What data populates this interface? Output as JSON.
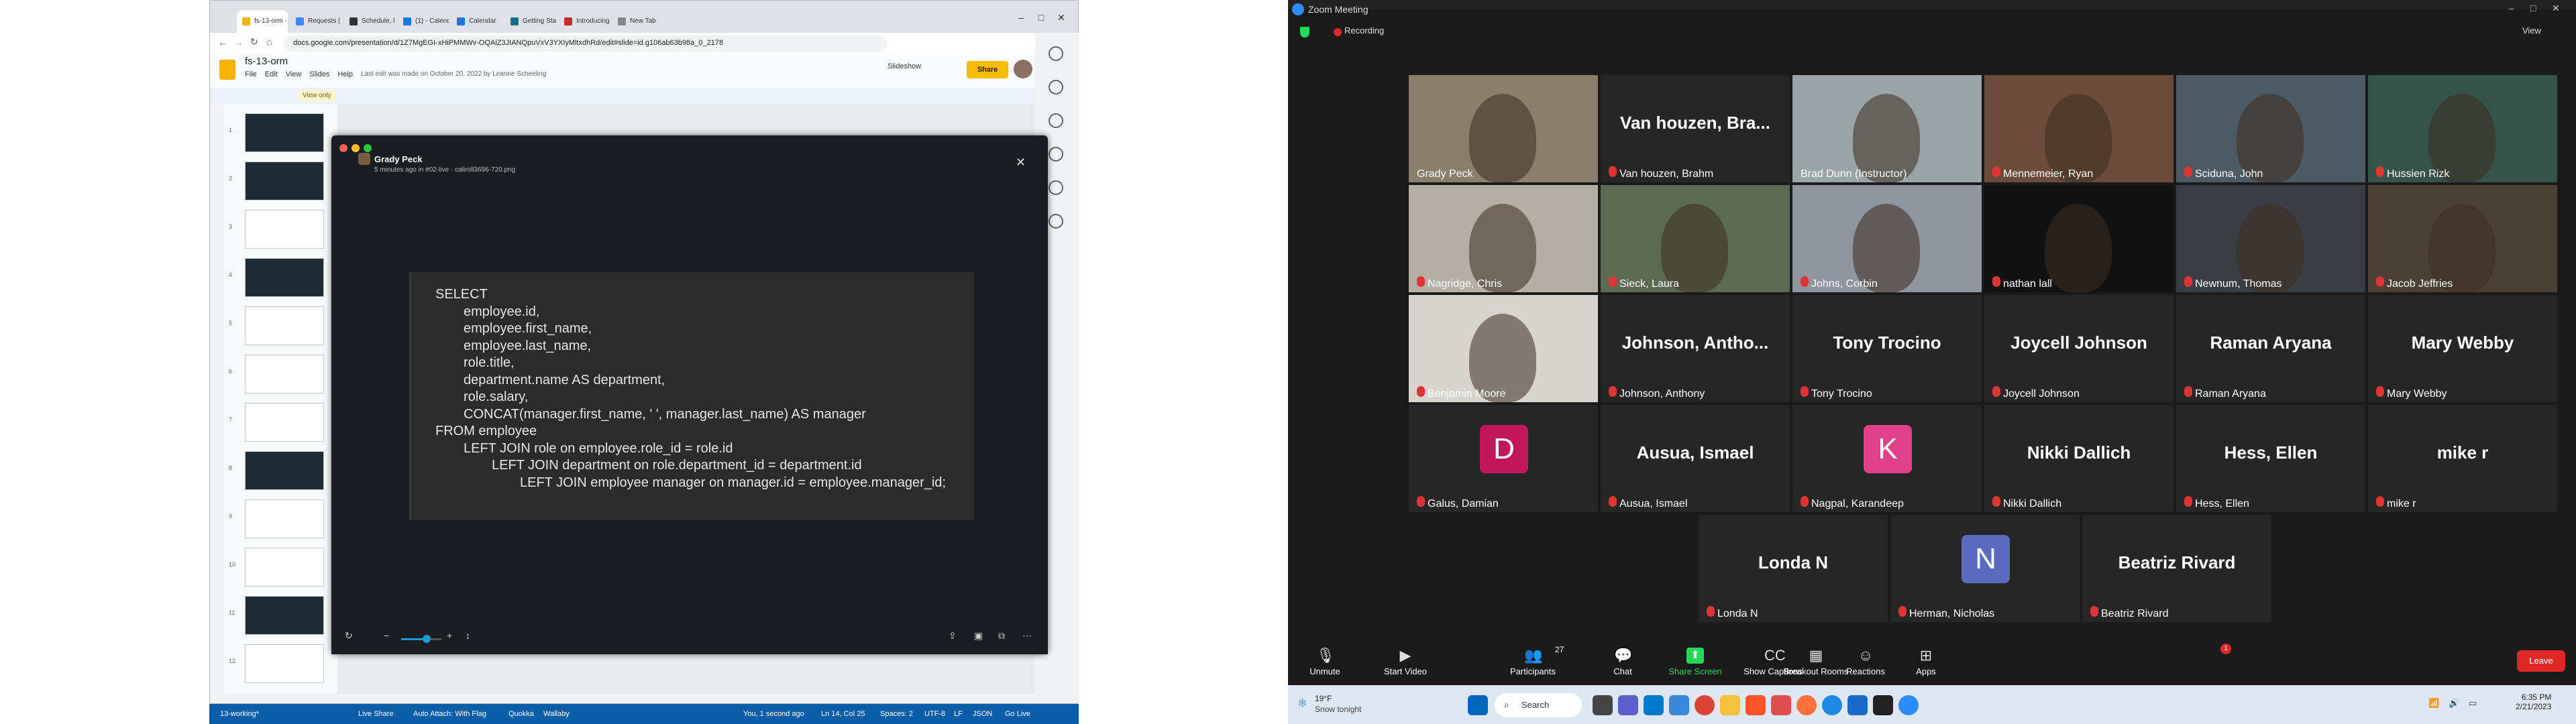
{
  "chrome": {
    "tabs": [
      {
        "label": "fs-13-orm - Google Slides",
        "color": "#f4b400",
        "active": true
      },
      {
        "label": "Requests | Instructor",
        "color": "#4285f4",
        "active": false
      },
      {
        "label": "Schedule, live/02-...",
        "color": "#333333",
        "active": false
      },
      {
        "label": "(1) - Calendar - Inst...",
        "color": "#1a73e8",
        "active": false
      },
      {
        "label": "Calendar",
        "color": "#1a73e8",
        "active": false
      },
      {
        "label": "Getting Started | E...",
        "color": "#0b7285",
        "active": false
      },
      {
        "label": "Introducing the new...",
        "color": "#c92a2a",
        "active": false
      },
      {
        "label": "New Tab",
        "color": "#888888",
        "active": false
      }
    ],
    "url": "docs.google.com/presentation/d/1Z7MgEGI-xHiPMMWv-OQAiZ3JIANQpuVxV3YXIyMltxdhRd/edit#slide=id.g106ab63b98a_0_2178"
  },
  "slides": {
    "title": "fs-13-orm",
    "menu": [
      "File",
      "Edit",
      "View",
      "Slides",
      "Help"
    ],
    "last_edit": "Last edit was made on October 20, 2022 by Leanne Scheeling",
    "slideshow_label": "Slideshow",
    "share_label": "Share",
    "view_only": "View only",
    "slide_numbers": [
      "1",
      "2",
      "3",
      "4",
      "5",
      "6",
      "7",
      "8",
      "9",
      "10",
      "11",
      "12"
    ]
  },
  "viewer": {
    "sender": "Grady Peck",
    "meta": "5 minutes ago in #02-live · caliroll3696-720.png",
    "code_lines": [
      {
        "indent": 0,
        "text": "SELECT"
      },
      {
        "indent": 1,
        "text": "employee.id,"
      },
      {
        "indent": 1,
        "text": "employee.first_name,"
      },
      {
        "indent": 1,
        "text": "employee.last_name,"
      },
      {
        "indent": 1,
        "text": "role.title,"
      },
      {
        "indent": 1,
        "text": "department.name AS department,"
      },
      {
        "indent": 1,
        "text": "role.salary,"
      },
      {
        "indent": 1,
        "text": "CONCAT(manager.first_name, ' ', manager.last_name) AS manager"
      },
      {
        "indent": 0,
        "text": "FROM employee"
      },
      {
        "indent": 1,
        "text": "LEFT JOIN role on employee.role_id = role.id"
      },
      {
        "indent": 2,
        "text": "LEFT JOIN department on role.department_id = department.id"
      },
      {
        "indent": 3,
        "text": "LEFT JOIN employee manager on manager.id = employee.manager_id;"
      }
    ]
  },
  "vscode_status": {
    "branch": "13-working*",
    "live_share": "Live Share",
    "auto_attach": "Auto Attach: With Flag",
    "quokka": "Quokka",
    "wallaby": "Wallaby",
    "git_info": "You, 1 second ago",
    "cursor": "Ln 14, Col 25",
    "spaces": "Spaces: 2",
    "encoding": "UTF-8",
    "eol": "LF",
    "lang": "JSON",
    "golive": "Go Live"
  },
  "zoom": {
    "title": "Zoom Meeting",
    "recording": "Recording",
    "view": "View",
    "tiles": [
      {
        "name": "Grady Peck",
        "type": "video",
        "bg": "#8a7f6d",
        "mic_muted": false
      },
      {
        "name": "Van houzen, Brahm",
        "type": "name",
        "big": "Van houzen, Bra...",
        "mic_muted": true
      },
      {
        "name": "Brad Dunn (Instructor)",
        "type": "video",
        "bg": "#9aa3a6",
        "mic_muted": false,
        "highlight": true
      },
      {
        "name": "Mennemeier, Ryan",
        "type": "video",
        "bg": "#6b4c3b",
        "mic_muted": true
      },
      {
        "name": "Sciduna, John",
        "type": "video",
        "bg": "#4e5a63",
        "mic_muted": true
      },
      {
        "name": "Hussien Rizk",
        "type": "video",
        "bg": "#36534a",
        "mic_muted": true
      },
      {
        "name": "Nagridge, Chris",
        "type": "video",
        "bg": "#b4aea4",
        "mic_muted": true
      },
      {
        "name": "Sieck, Laura",
        "type": "video",
        "bg": "#5b6a52",
        "mic_muted": true
      },
      {
        "name": "Johns, Corbin",
        "type": "video",
        "bg": "#8f96a0",
        "mic_muted": true
      },
      {
        "name": "nathan lall",
        "type": "video",
        "bg": "#111111",
        "mic_muted": true
      },
      {
        "name": "Newnum, Thomas",
        "type": "video",
        "bg": "#3a3d44",
        "mic_muted": true
      },
      {
        "name": "Jacob Jeffries",
        "type": "video",
        "bg": "#4a4036",
        "mic_muted": true
      },
      {
        "name": "Benjamin Moore",
        "type": "video",
        "bg": "#d8d4cf",
        "mic_muted": true
      },
      {
        "name": "Johnson, Anthony",
        "type": "name",
        "big": "Johnson,  Antho...",
        "mic_muted": true
      },
      {
        "name": "Tony Trocino",
        "type": "name",
        "big": "Tony Trocino",
        "mic_muted": true
      },
      {
        "name": "Joycell Johnson",
        "type": "name",
        "big": "Joycell Johnson",
        "mic_muted": true
      },
      {
        "name": "Raman Aryana",
        "type": "name",
        "big": "Raman Aryana",
        "mic_muted": true
      },
      {
        "name": "Mary Webby",
        "type": "name",
        "big": "Mary Webby",
        "mic_muted": true
      },
      {
        "name": "Galus, Damian",
        "type": "avatar",
        "letter": "D",
        "avatar_color": "#c2185b",
        "mic_muted": true
      },
      {
        "name": "Ausua, Ismael",
        "type": "name",
        "big": "Ausua, Ismael",
        "mic_muted": true
      },
      {
        "name": "Nagpal, Karandeep",
        "type": "avatar",
        "letter": "K",
        "avatar_color": "#e0408a",
        "mic_muted": true
      },
      {
        "name": "Nikki Dallich",
        "type": "name",
        "big": "Nikki Dallich",
        "mic_muted": true
      },
      {
        "name": "Hess, Ellen",
        "type": "name",
        "big": "Hess, Ellen",
        "mic_muted": true
      },
      {
        "name": "mike r",
        "type": "name",
        "big": "mike r",
        "mic_muted": true
      },
      {
        "name": "Londa N",
        "type": "name",
        "big": "Londa N",
        "mic_muted": true
      },
      {
        "name": "Herman, Nicholas",
        "type": "avatar",
        "letter": "N",
        "avatar_color": "#5c6bc0",
        "mic_muted": true
      },
      {
        "name": "Beatriz Rivard",
        "type": "name",
        "big": "Beatriz Rivard",
        "mic_muted": true
      }
    ],
    "toolbar": {
      "unmute": "Unmute",
      "start_video": "Start Video",
      "participants": "Participants",
      "participants_count": "27",
      "chat": "Chat",
      "chat_badge": "1",
      "share_screen": "Share Screen",
      "show_captions": "Show Captions",
      "breakout_rooms": "Breakout Rooms",
      "reactions": "Reactions",
      "apps": "Apps",
      "leave": "Leave"
    }
  },
  "taskbar": {
    "temp": "19°F",
    "weather": "Snow tonight",
    "search": "Search",
    "time": "6:35 PM",
    "date": "2/21/2023"
  },
  "colors": {
    "zoom_bg": "#1a1a1a",
    "tile_bg": "#262626",
    "vscode_status": "#0a5ea8",
    "share_screen_green": "#23d959",
    "leave_red": "#e02828"
  }
}
